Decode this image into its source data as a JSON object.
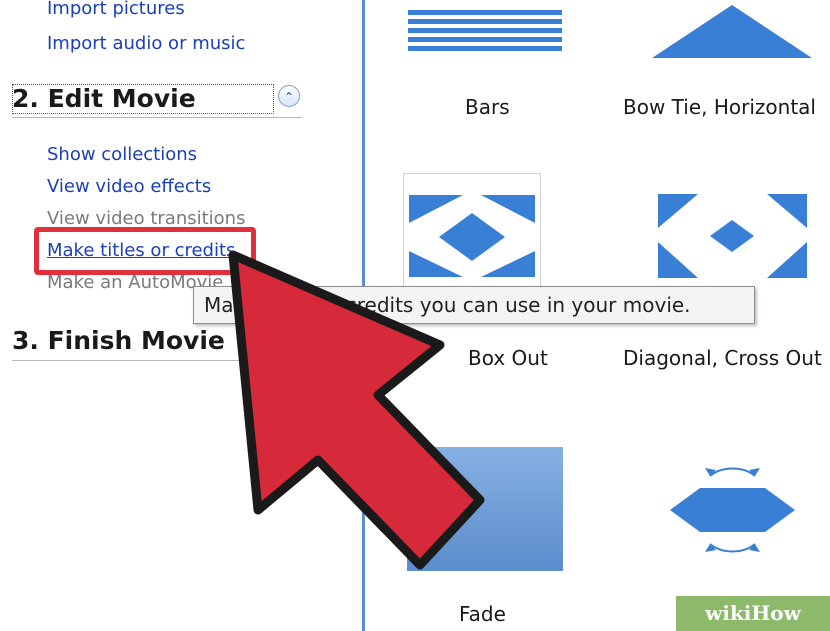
{
  "tasks": {
    "import_pictures_label": "Import pictures",
    "import_audio_label": "Import audio or music",
    "edit_movie_header": "2. Edit Movie",
    "edit_items": [
      {
        "label": "Show collections"
      },
      {
        "label": "View video effects"
      },
      {
        "label": "View video transitions"
      },
      {
        "label": "Make titles or credits"
      },
      {
        "label": "Make an AutoMovie"
      }
    ],
    "finish_movie_header": "3. Finish Movie"
  },
  "tooltip": {
    "text": "Make titles or credits you can use in your movie."
  },
  "transitions": [
    {
      "label": "Bars"
    },
    {
      "label": "Bow Tie, Horizontal"
    },
    {
      "label": "Box Out"
    },
    {
      "label": "Diagonal, Cross Out"
    },
    {
      "label": "Fade"
    },
    {
      "label": ""
    }
  ],
  "watermark": {
    "text": "wikiHow"
  },
  "colors": {
    "link": "#1a3fb8",
    "accent_blue": "#3a7fd6",
    "highlight_red": "#e0303c",
    "arrow_red": "#d62a3a"
  }
}
